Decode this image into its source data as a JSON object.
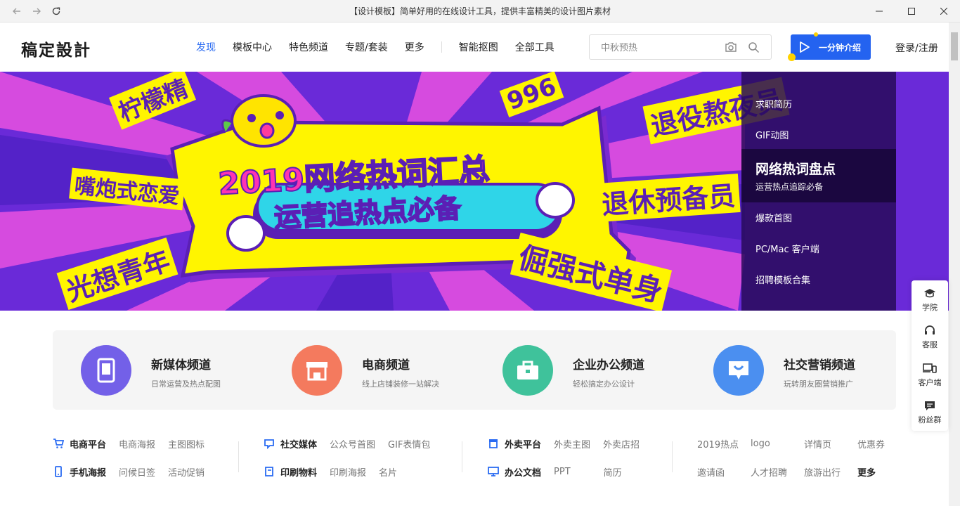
{
  "window": {
    "title": "【设计模板】简单好用的在线设计工具，提供丰富精美的设计图片素材"
  },
  "header": {
    "logo": "稿定設計",
    "nav": [
      "发现",
      "模板中心",
      "特色频道",
      "专题/套装",
      "更多"
    ],
    "nav2": [
      "智能抠图",
      "全部工具"
    ],
    "search_placeholder": "中秋预热",
    "intro_button": "一分钟介绍",
    "login": "登录/注册"
  },
  "banner": {
    "headline": "2019网络热词汇总",
    "subline": "运营追热点必备",
    "stickers": [
      "柠檬精",
      "嘴炮式恋爱",
      "光想青年",
      "退役熬夜员",
      "退休预备员",
      "倔强式单身",
      "996"
    ],
    "side_menu": [
      {
        "label": "求职简历"
      },
      {
        "label": "GIF动图"
      },
      {
        "label": "网络热词盘点",
        "sub": "运营热点追踪必备",
        "active": true
      },
      {
        "label": "爆款首图"
      },
      {
        "label": "PC/Mac 客户端"
      },
      {
        "label": "招聘模板合集"
      }
    ]
  },
  "channels": [
    {
      "title": "新媒体频道",
      "sub": "日常运营及热点配图",
      "color": "#7360e8",
      "icon": "tablet-icon"
    },
    {
      "title": "电商频道",
      "sub": "线上店铺装修一站解决",
      "color": "#f47a5e",
      "icon": "shop-icon"
    },
    {
      "title": "企业办公频道",
      "sub": "轻松搞定办公设计",
      "color": "#3fc29b",
      "icon": "briefcase-icon"
    },
    {
      "title": "社交营销频道",
      "sub": "玩转朋友圈营销推广",
      "color": "#4b8ff0",
      "icon": "chat-icon"
    }
  ],
  "categories": {
    "row1": [
      {
        "head": "电商平台",
        "links": [
          "电商海报",
          "主图图标"
        ]
      },
      {
        "head": "社交媒体",
        "links": [
          "公众号首图",
          "GIF表情包"
        ]
      },
      {
        "head": "外卖平台",
        "links": [
          "外卖主图",
          "外卖店招"
        ]
      }
    ],
    "row2": [
      {
        "head": "手机海报",
        "links": [
          "问候日签",
          "活动促销"
        ]
      },
      {
        "head": "印刷物料",
        "links": [
          "印刷海报",
          "名片"
        ]
      },
      {
        "head": "办公文档",
        "links": [
          "PPT",
          "简历"
        ]
      }
    ],
    "misc_row1": [
      "2019热点",
      "logo",
      "详情页",
      "优惠券"
    ],
    "misc_row2": [
      "邀请函",
      "人才招聘",
      "旅游出行",
      "更多"
    ]
  },
  "float_tools": [
    "学院",
    "客服",
    "客户端",
    "粉丝群"
  ]
}
